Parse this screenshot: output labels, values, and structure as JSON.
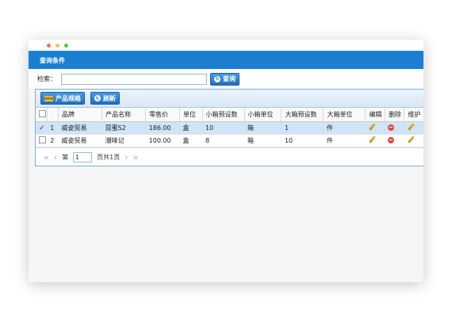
{
  "window": {
    "title": "查询条件"
  },
  "search": {
    "label": "检索：",
    "value": "",
    "button_label": "查询"
  },
  "toolbar": {
    "product_spec_label": "产品规格",
    "refresh_label": "刷新"
  },
  "table": {
    "headers": [
      "品牌",
      "产品名称",
      "零售价",
      "单位",
      "小箱预设数",
      "小箱单位",
      "大箱预设数",
      "大箱单位",
      "编辑",
      "删除",
      "维护"
    ],
    "rows": [
      {
        "selected": true,
        "index": "1",
        "brand": "威姿贸易",
        "name": "昆蜜S2",
        "price": "186.00",
        "unit": "盒",
        "small_qty": "10",
        "small_unit": "箱",
        "large_qty": "1",
        "large_unit": "件"
      },
      {
        "selected": false,
        "index": "2",
        "brand": "威姿贸易",
        "name": "潮味记",
        "price": "100.00",
        "unit": "盒",
        "small_qty": "8",
        "small_unit": "箱",
        "large_qty": "10",
        "large_unit": "件"
      }
    ]
  },
  "pager": {
    "page_prefix": "第",
    "page_value": "1",
    "page_suffix": "页共1页"
  },
  "colors": {
    "accent": "#1b7fd1",
    "selected_row": "#cfe4f7"
  }
}
